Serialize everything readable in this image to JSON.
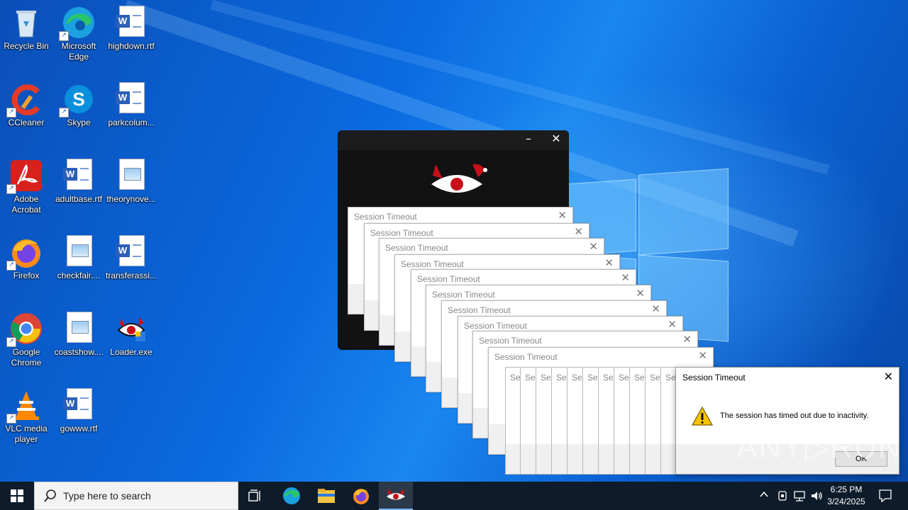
{
  "desktop": {
    "icons": [
      {
        "label": "Recycle Bin",
        "icon": "recycle-bin-icon"
      },
      {
        "label": "Microsoft Edge",
        "icon": "edge-icon"
      },
      {
        "label": "highdown.rtf",
        "icon": "word-document-icon"
      },
      {
        "label": "CCleaner",
        "icon": "ccleaner-icon"
      },
      {
        "label": "Skype",
        "icon": "skype-icon"
      },
      {
        "label": "parkcolum...",
        "icon": "word-document-icon"
      },
      {
        "label": "Adobe Acrobat",
        "icon": "acrobat-icon"
      },
      {
        "label": "adultbase.rtf",
        "icon": "word-document-icon"
      },
      {
        "label": "theorynove...",
        "icon": "image-file-icon"
      },
      {
        "label": "Firefox",
        "icon": "firefox-icon"
      },
      {
        "label": "checkfair....",
        "icon": "image-file-icon"
      },
      {
        "label": "transferassi...",
        "icon": "word-document-icon"
      },
      {
        "label": "Google Chrome",
        "icon": "chrome-icon"
      },
      {
        "label": "coastshow....",
        "icon": "image-file-icon"
      },
      {
        "label": "Loader.exe",
        "icon": "loader-exe-icon"
      },
      {
        "label": "VLC media player",
        "icon": "vlc-icon"
      },
      {
        "label": "gowww.rtf",
        "icon": "word-document-icon"
      }
    ]
  },
  "loader_window": {
    "minimize": "–",
    "close": "✕"
  },
  "dialogs": {
    "title": "Session Timeout",
    "truncated_title": "Se",
    "close": "✕",
    "message": "The session has timed out due to inactivity.",
    "ok_label": "OK"
  },
  "watermark": "ANY▷RUN",
  "taskbar": {
    "search_placeholder": "Type here to search",
    "time": "6:25 PM",
    "date": "3/24/2025"
  },
  "colors": {
    "accent": "#0a64d2",
    "taskbar": "#0e1b2a"
  }
}
